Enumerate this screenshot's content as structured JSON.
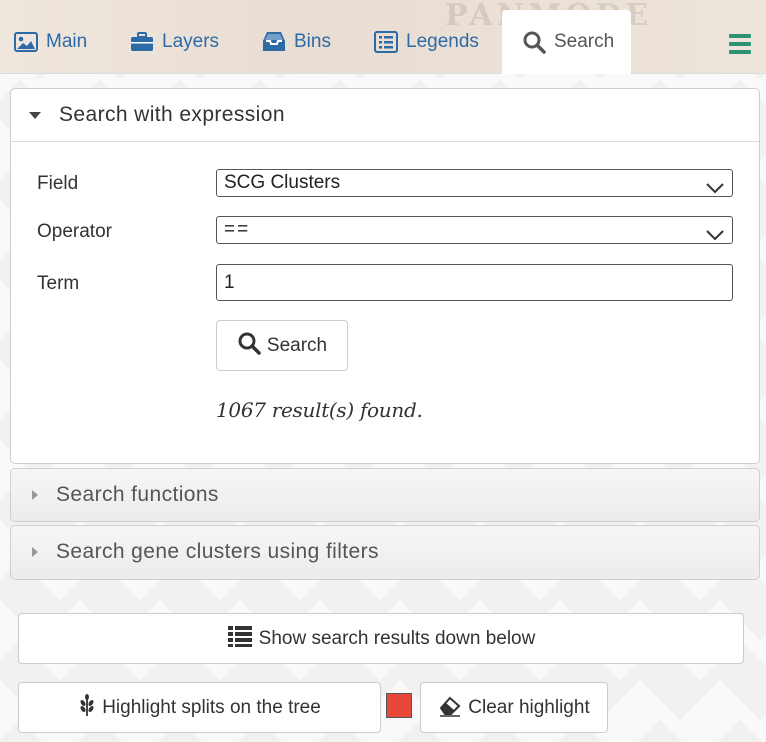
{
  "nav": {
    "logo": "PANMODE",
    "tabs": [
      {
        "label": "Main",
        "icon": "image-icon"
      },
      {
        "label": "Layers",
        "icon": "briefcase-icon"
      },
      {
        "label": "Bins",
        "icon": "inbox-icon"
      },
      {
        "label": "Legends",
        "icon": "list-alt-icon"
      },
      {
        "label": "Search",
        "icon": "search-icon",
        "active": true
      }
    ],
    "menu_icon": "hamburger-menu-icon",
    "link_color": "#2d6aa8",
    "menu_color": "#2e9173"
  },
  "search_expression": {
    "title": "Search with expression",
    "field_label": "Field",
    "field_value": "SCG Clusters",
    "operator_label": "Operator",
    "operator_value": "==",
    "term_label": "Term",
    "term_value": "1",
    "search_button": "Search",
    "result": "1067 result(s) found."
  },
  "search_functions": {
    "title": "Search functions"
  },
  "search_gene_clusters": {
    "title": "Search gene clusters using filters"
  },
  "actions": {
    "show_results": "Show search results down below",
    "highlight_splits": "Highlight splits on the tree",
    "highlight_color": "#e8473a",
    "clear_highlight": "Clear highlight"
  }
}
